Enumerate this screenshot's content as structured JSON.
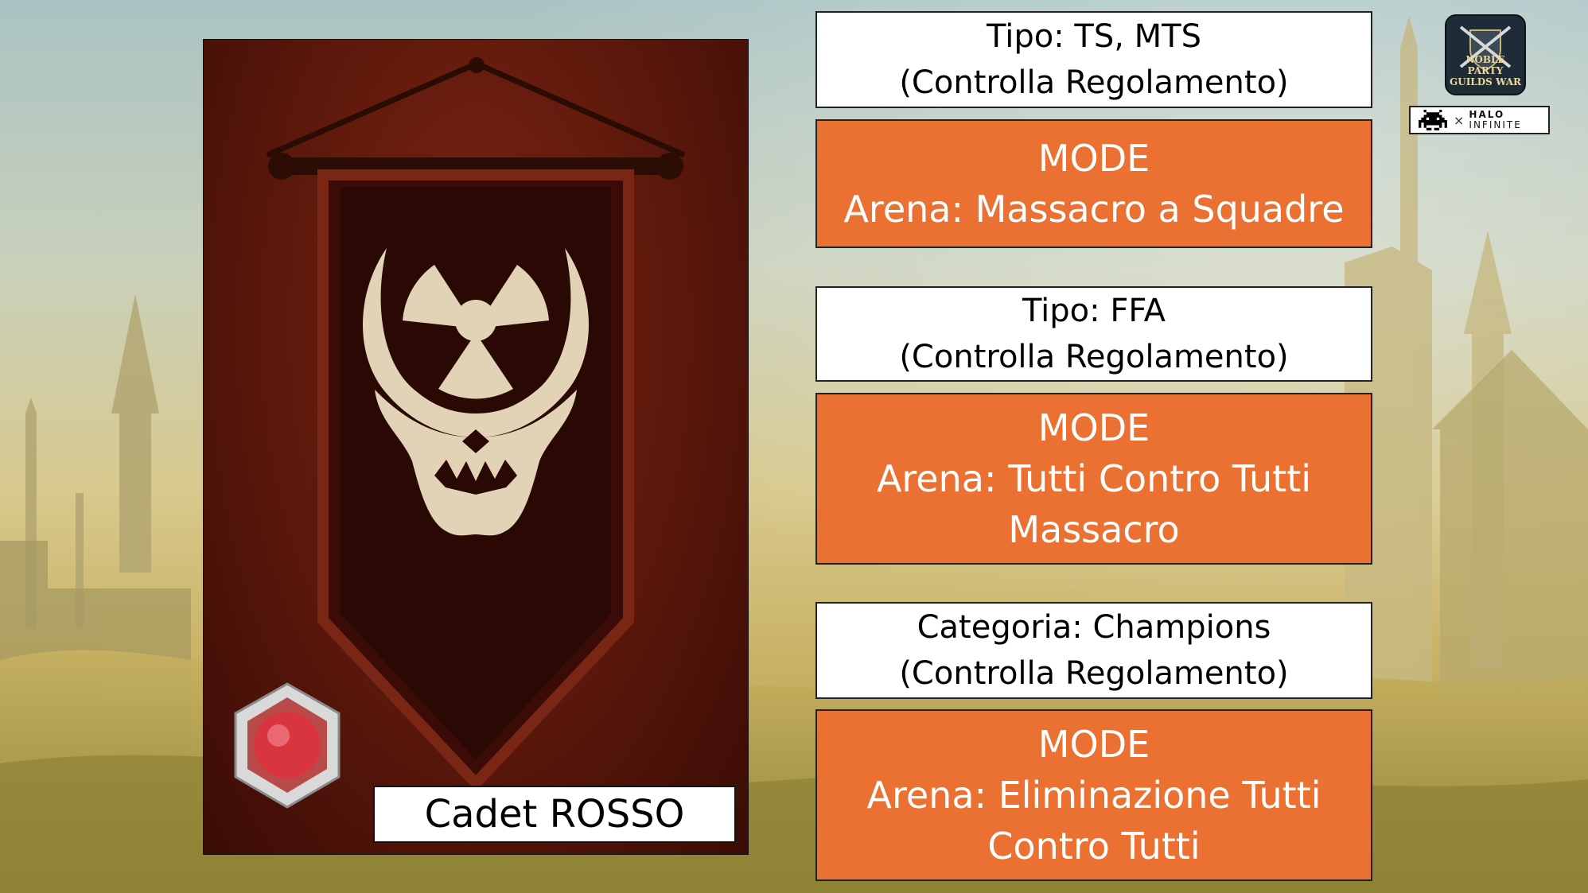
{
  "team": {
    "name": "Cadet ROSSO"
  },
  "modes": [
    {
      "info_lines": [
        "Tipo: TS, MTS",
        "(Controlla Regolamento)"
      ],
      "mode_lines": [
        "MODE",
        "Arena: Massacro a Squadre"
      ]
    },
    {
      "info_lines": [
        "Tipo: FFA",
        "(Controlla Regolamento)"
      ],
      "mode_lines": [
        "MODE",
        "Arena: Tutti Contro Tutti",
        "Massacro"
      ]
    },
    {
      "info_lines": [
        "Categoria: Champions",
        "(Controlla Regolamento)"
      ],
      "mode_lines": [
        "MODE",
        "Arena: Eliminazione Tutti",
        "Contro Tutti"
      ]
    }
  ],
  "logos": {
    "guild": {
      "text_lines": [
        "NOBLE PARTY",
        "GUILDS WAR"
      ]
    },
    "halo": {
      "separator": "×",
      "brand_top": "HALO",
      "brand_bottom": "INFINITE"
    }
  },
  "icons": {
    "banner_emblem": "radioactive-skull-icon",
    "rank_badge": "red-hexagon-rank-icon",
    "space_invader": "space-invader-icon"
  },
  "colors": {
    "mode_box": "#ea7132",
    "info_box": "#ffffff",
    "banner_red": "#5a170b",
    "emblem": "#e2d3b6"
  }
}
